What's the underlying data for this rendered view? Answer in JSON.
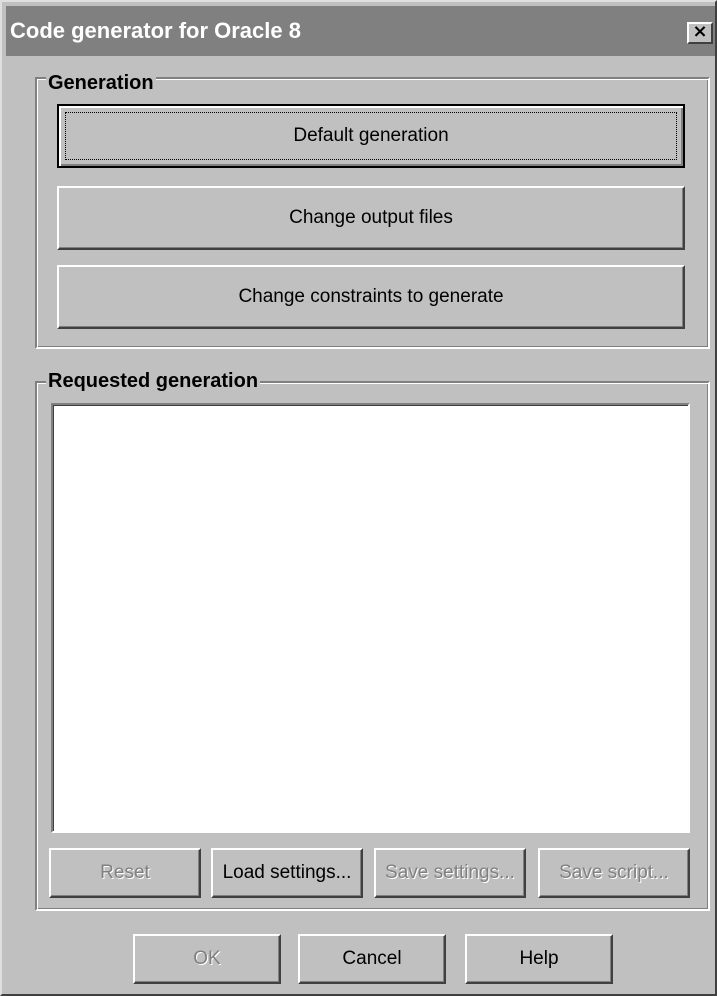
{
  "window": {
    "title": "Code generator for Oracle 8",
    "close_label": "×"
  },
  "generation": {
    "legend": "Generation",
    "default_label": "Default generation",
    "change_output_label": "Change output files",
    "change_constraints_label": "Change constraints to generate"
  },
  "requested": {
    "legend": "Requested generation",
    "items": [],
    "reset_label": "Reset",
    "load_label": "Load settings...",
    "save_settings_label": "Save settings...",
    "save_script_label": "Save script..."
  },
  "footer": {
    "ok_label": "OK",
    "cancel_label": "Cancel",
    "help_label": "Help"
  }
}
